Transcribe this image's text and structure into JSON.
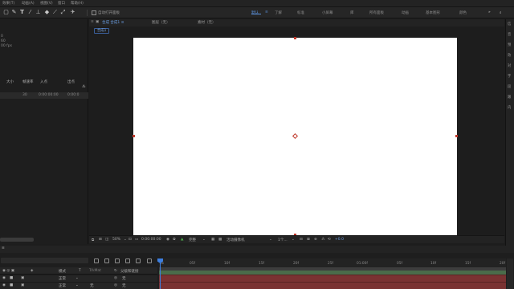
{
  "menu": [
    "效果(T)",
    "动画(A)",
    "视图(V)",
    "窗口",
    "帮助(H)"
  ],
  "toolbar": {
    "tool_icons": [
      "pen-icon",
      "text-icon",
      "brush-icon",
      "stamp-icon",
      "eraser-icon",
      "roto-icon",
      "puppet-icon"
    ],
    "auto_open_label": "自动打开面板",
    "workspaces": [
      "默认",
      "了解",
      "标准",
      "小屏幕",
      "库",
      "所有面板",
      "动画",
      "基本图形",
      "颜色"
    ],
    "active_workspace": "默认"
  },
  "project_panel": {
    "info_lines": [
      "0",
      "60",
      "00 fps"
    ],
    "columns": [
      "大小",
      "帧速率",
      "入点",
      "出点"
    ],
    "row": [
      "30",
      "0:00:00:00",
      "0:00:0"
    ]
  },
  "viewer": {
    "tabs": [
      "合成 合成1 ≡",
      "图层（无）",
      "素材（无）"
    ],
    "breadcrumb": "合成1",
    "footer": {
      "zoom": "50%",
      "timecode": "0:00:00:00",
      "resolution": "完整",
      "camera": "活动摄像机",
      "views": "1个...",
      "exposure": "+0.0"
    }
  },
  "right_panel": [
    "信",
    "音",
    "预",
    "效",
    "对",
    "字",
    "段",
    "跟",
    "内"
  ],
  "timeline": {
    "ruler": [
      "0s",
      "05f",
      "10f",
      "15f",
      "20f",
      "25f",
      "01:00f",
      "05f",
      "10f",
      "15f",
      "20f"
    ],
    "headers": [
      "模式",
      "T",
      "TrkMat",
      "父级和链接"
    ],
    "rows": [
      {
        "mode": "正常",
        "parent": "无"
      },
      {
        "mode": "正常",
        "trkmat": "无",
        "parent": "无"
      }
    ]
  },
  "colors": {
    "accent": "#3d7fe0",
    "canvas": "#ffffff",
    "layer_bar": "#7a3232",
    "handle": "#c0392b"
  }
}
